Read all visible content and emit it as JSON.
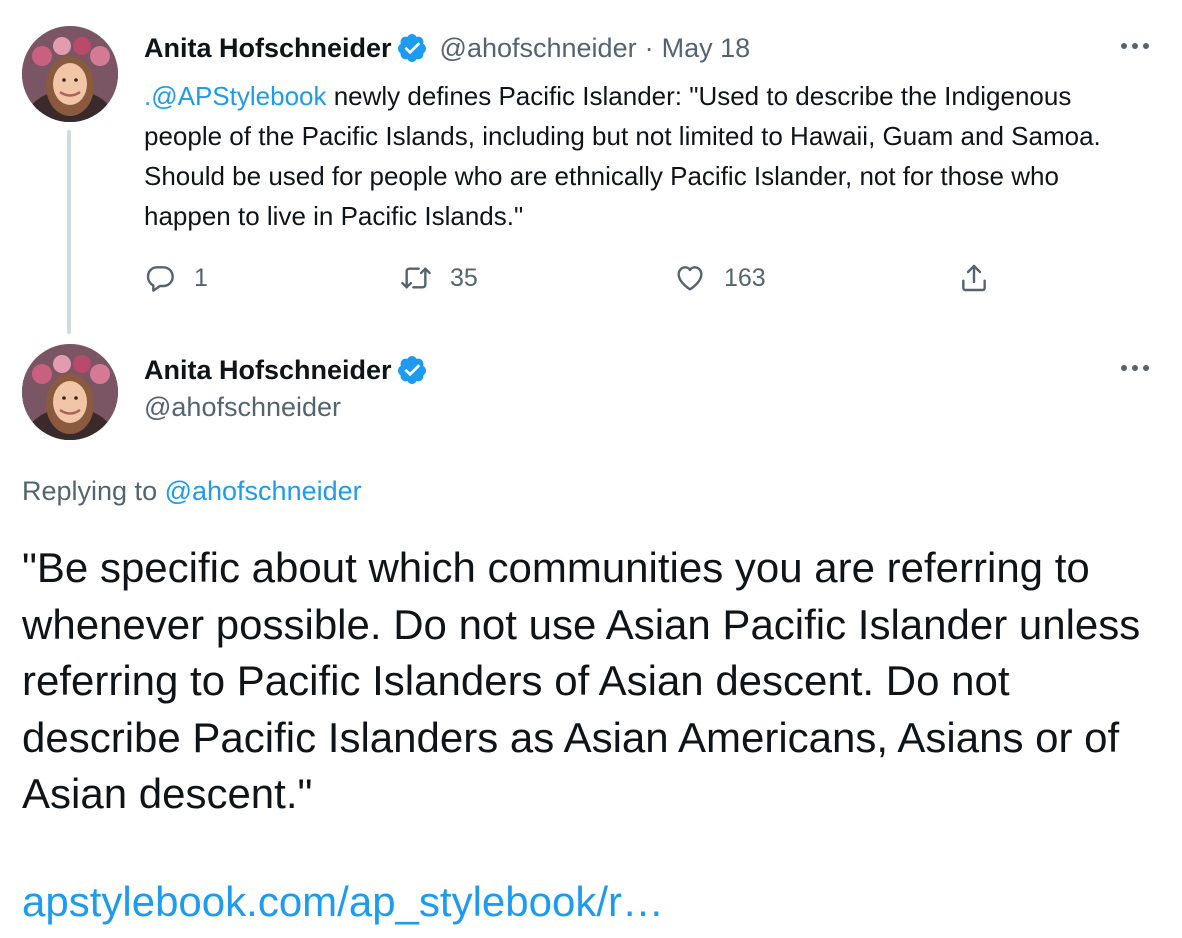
{
  "first_tweet": {
    "author_name": "Anita Hofschneider",
    "handle": "@ahofschneider",
    "separator": "·",
    "date": "May 18",
    "mention": ".@APStylebook",
    "text_rest": " newly defines Pacific Islander: \"Used to describe the Indigenous people of the Pacific Islands, including but not limited to Hawaii, Guam and Samoa. Should be used for people who are ethnically Pacific Islander, not for those who happen to live in Pacific Islands.\"",
    "reply_count": "1",
    "retweet_count": "35",
    "like_count": "163"
  },
  "second_tweet": {
    "author_name": "Anita Hofschneider",
    "handle": "@ahofschneider",
    "replying_prefix": "Replying to ",
    "replying_handle": "@ahofschneider",
    "text": "\"Be specific about which communities you are referring to whenever possible. Do not use Asian Pacific Islander unless referring to Pacific Islanders of Asian descent. Do not describe Pacific Islanders as Asian Americans, Asians or of Asian descent.\"",
    "link": "apstylebook.com/ap_stylebook/r…"
  },
  "icons": {
    "verified": "verified-badge-icon",
    "more": "more-options-icon",
    "reply": "reply-icon",
    "retweet": "retweet-icon",
    "like": "like-icon",
    "share": "share-icon"
  },
  "colors": {
    "accent": "#1d9bf0",
    "text": "#0f1419",
    "muted": "#536471"
  }
}
